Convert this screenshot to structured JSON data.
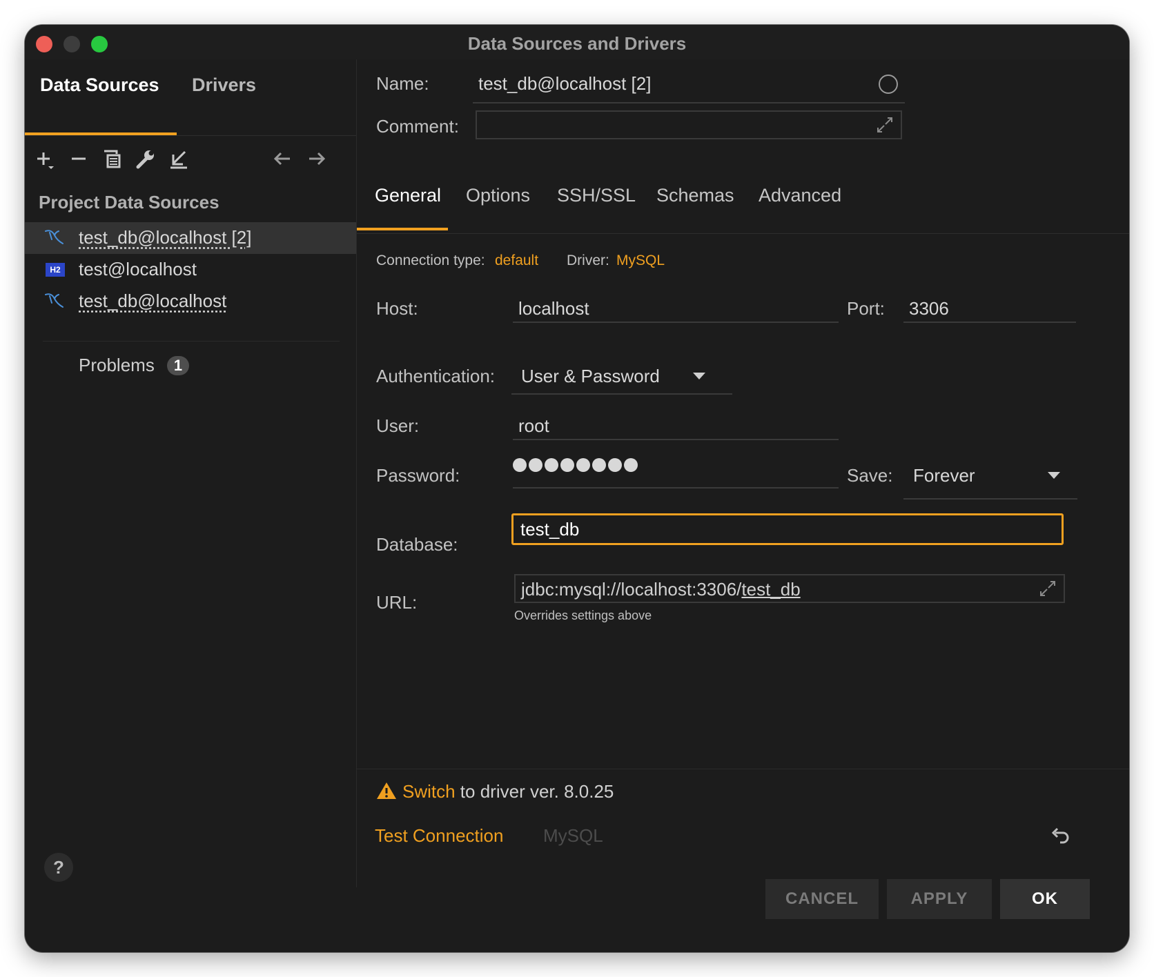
{
  "window": {
    "title": "Data Sources and Drivers"
  },
  "left": {
    "tabs": [
      "Data Sources",
      "Drivers"
    ],
    "toolbar_icons": [
      "add-icon",
      "remove-icon",
      "duplicate-icon",
      "wrench-icon",
      "import-icon",
      "back-arrow-icon",
      "forward-arrow-icon"
    ],
    "section_title": "Project Data Sources",
    "items": [
      {
        "label": "test_db@localhost [2]",
        "icon": "mysql-icon"
      },
      {
        "label": "test@localhost",
        "icon": "h2-icon",
        "icon_text": "H2"
      },
      {
        "label": "test_db@localhost",
        "icon": "mysql-icon"
      }
    ],
    "problems": {
      "label": "Problems",
      "count": "1"
    },
    "help": "?"
  },
  "form": {
    "name_label": "Name:",
    "name_value": "test_db@localhost [2]",
    "comment_label": "Comment:",
    "comment_value": "",
    "tabs": [
      "General",
      "Options",
      "SSH/SSL",
      "Schemas",
      "Advanced"
    ],
    "connection_type_label": "Connection type:",
    "connection_type_value": "default",
    "driver_label": "Driver:",
    "driver_value": "MySQL",
    "host_label": "Host:",
    "host_value": "localhost",
    "port_label": "Port:",
    "port_value": "3306",
    "auth_label": "Authentication:",
    "auth_value": "User & Password",
    "user_label": "User:",
    "user_value": "root",
    "password_label": "Password:",
    "password_dots": 8,
    "save_label": "Save:",
    "save_value": "Forever",
    "database_label": "Database:",
    "database_value": "test_db",
    "url_label": "URL:",
    "url_prefix": "jdbc:mysql://localhost:3306/",
    "url_db": "test_db",
    "url_hint": "Overrides settings above"
  },
  "footer": {
    "warning_link": "Switch",
    "warning_text": " to driver ver. 8.0.25",
    "test_connection": "Test Connection",
    "driver_hint": "MySQL",
    "buttons": {
      "cancel": "CANCEL",
      "apply": "APPLY",
      "ok": "OK"
    }
  },
  "colors": {
    "accent": "#f0a020",
    "window_bg": "#1c1c1c",
    "h2_badge": "#2b45c8",
    "mysql_icon": "#4a90d9"
  }
}
